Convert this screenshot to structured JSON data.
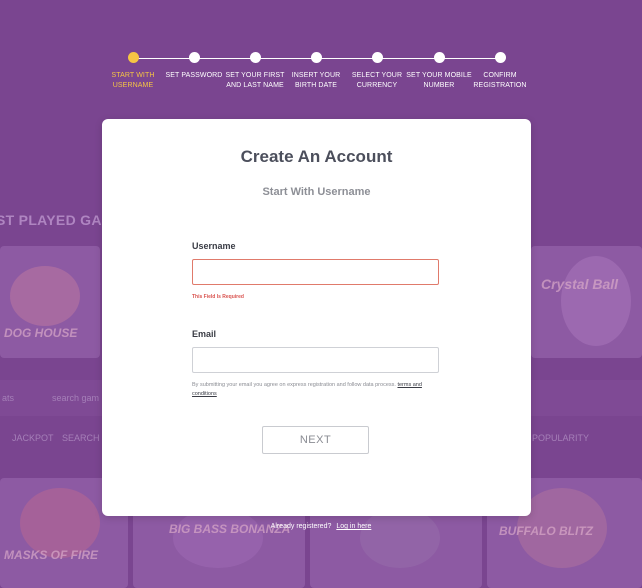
{
  "stepper": {
    "steps": [
      {
        "label_1": "START WITH",
        "label_2": "USERNAME",
        "active": true
      },
      {
        "label_1": "SET PASSWORD",
        "label_2": "",
        "active": false
      },
      {
        "label_1": "SET YOUR FIRST",
        "label_2": "AND LAST NAME",
        "active": false
      },
      {
        "label_1": "INSERT YOUR",
        "label_2": "BIRTH DATE",
        "active": false
      },
      {
        "label_1": "SELECT YOUR",
        "label_2": "CURRENCY",
        "active": false
      },
      {
        "label_1": "SET YOUR MOBILE",
        "label_2": "NUMBER",
        "active": false
      },
      {
        "label_1": "CONFIRM",
        "label_2": "REGISTRATION",
        "active": false
      }
    ],
    "active_color": "#f6c544"
  },
  "background": {
    "section_heading": "ST PLAYED GAM",
    "search_text": "search gam",
    "tab_left": "JACKPOT",
    "tab_left_2": "SEARCH",
    "tab_right": "POPULARITY",
    "side_text": "ats",
    "tiles": [
      "DOG HOUSE",
      "Crystal Ball",
      "MASKS OF FIRE",
      "BIG BASS BONANZA",
      "BUFFALO BLITZ"
    ]
  },
  "card": {
    "title": "Create An Account",
    "subtitle": "Start With Username",
    "username_label": "Username",
    "username_value": "",
    "username_error": "This Field Is Required",
    "email_label": "Email",
    "email_value": "",
    "note_text": "By submitting your email you agree on express registration and follow data process.",
    "terms_link": "terms and conditions",
    "next_label": "NEXT"
  },
  "footer": {
    "question": "Already registered?",
    "login_link": "Log in here"
  },
  "colors": {
    "background": "#7a4590",
    "error": "#d9534f"
  }
}
